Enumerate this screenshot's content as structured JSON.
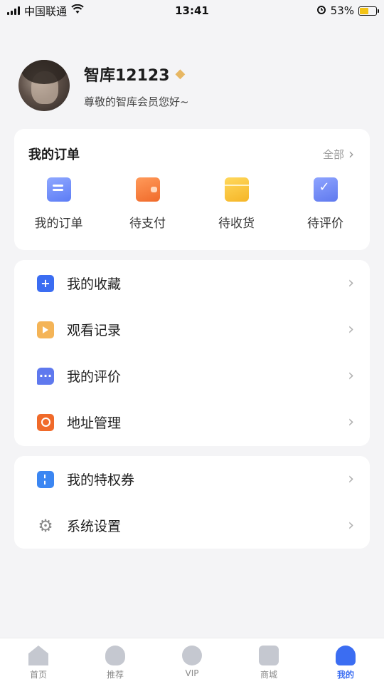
{
  "status_bar": {
    "carrier": "中国联通",
    "time": "13:41",
    "battery_percent": "53%",
    "icons": [
      "signal-icon",
      "wifi-icon",
      "alarm-icon",
      "battery-icon"
    ]
  },
  "profile": {
    "username": "智库12123",
    "greeting": "尊敬的智库会员您好~",
    "badge_icon": "diamond-icon"
  },
  "orders": {
    "title": "我的订单",
    "view_all": "全部",
    "items": [
      {
        "label": "我的订单",
        "icon": "order-list-icon"
      },
      {
        "label": "待支付",
        "icon": "wallet-icon"
      },
      {
        "label": "待收货",
        "icon": "package-icon"
      },
      {
        "label": "待评价",
        "icon": "review-check-icon"
      }
    ]
  },
  "menu": {
    "items": [
      {
        "label": "我的收藏",
        "icon": "favorite-plus-icon"
      },
      {
        "label": "观看记录",
        "icon": "video-history-icon"
      },
      {
        "label": "我的评价",
        "icon": "comment-icon"
      },
      {
        "label": "地址管理",
        "icon": "location-icon"
      }
    ]
  },
  "settings": {
    "items": [
      {
        "label": "我的特权券",
        "icon": "coupon-icon"
      },
      {
        "label": "系统设置",
        "icon": "gear-icon"
      }
    ]
  },
  "tab_bar": {
    "tabs": [
      {
        "label": "首页",
        "icon": "home-icon"
      },
      {
        "label": "推荐",
        "icon": "recommend-icon"
      },
      {
        "label": "VIP",
        "icon": "vip-crown-icon"
      },
      {
        "label": "商城",
        "icon": "shop-bag-icon"
      },
      {
        "label": "我的",
        "icon": "profile-icon"
      }
    ],
    "active": "我的"
  },
  "colors": {
    "accent": "#3b6df2",
    "background": "#f4f4f6",
    "vip_gold": "#e7b763"
  }
}
